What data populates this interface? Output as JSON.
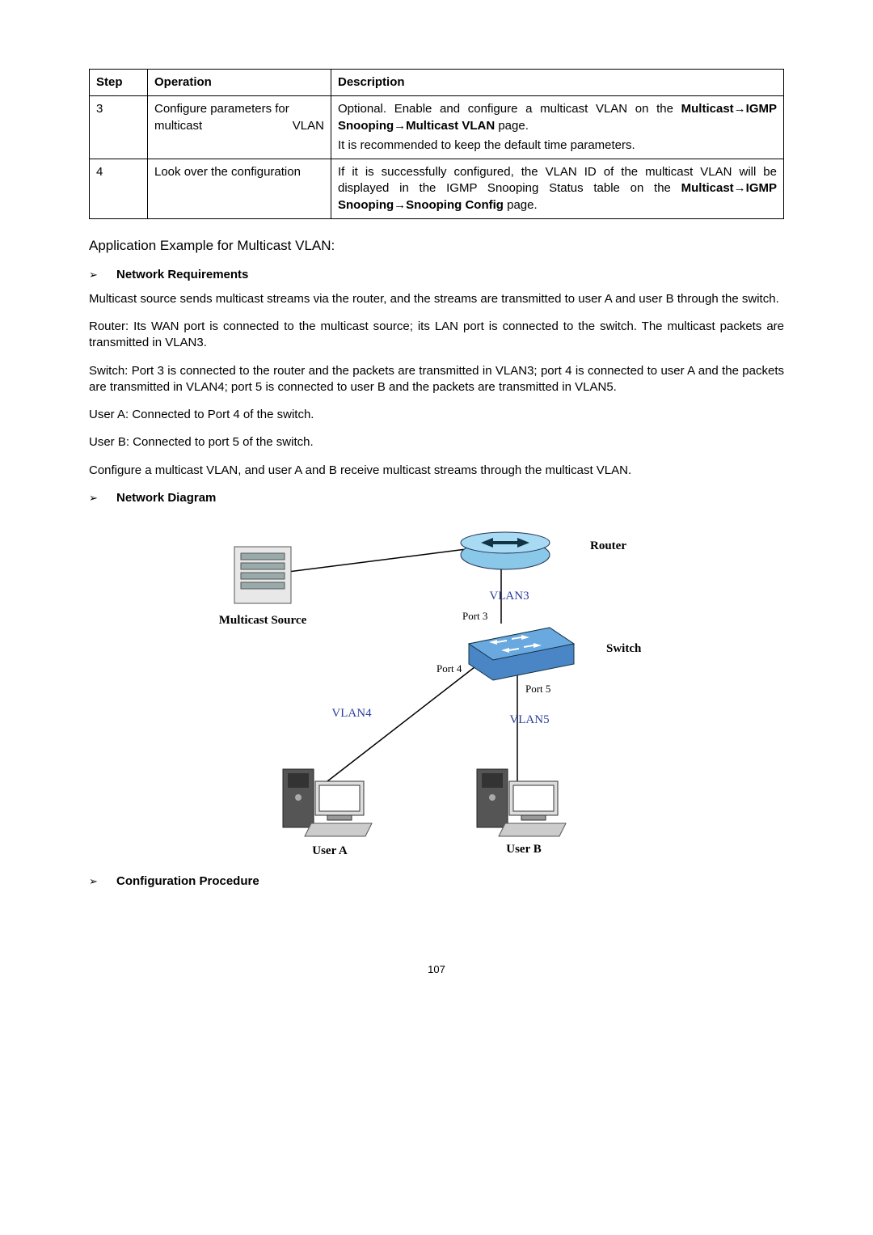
{
  "table": {
    "headers": {
      "step": "Step",
      "operation": "Operation",
      "description": "Description"
    },
    "rows": [
      {
        "step": "3",
        "operation": "Configure parameters for multicast VLAN",
        "desc_line1_pre": "Optional. Enable and configure a multicast VLAN on the ",
        "desc_line1_bold": "Multicast→IGMP Snooping→Multicast VLAN",
        "desc_line1_post": " page.",
        "desc_line2": "It is recommended to keep the default time parameters."
      },
      {
        "step": "4",
        "operation": "Look over the configuration",
        "desc_line1_pre": "If it is successfully configured, the VLAN ID of the multicast VLAN will be displayed in the IGMP Snooping Status table on the ",
        "desc_line1_bold": "Multicast→IGMP Snooping→Snooping Config",
        "desc_line1_post": " page."
      }
    ]
  },
  "heading_app": "Application Example for Multicast VLAN:",
  "bullets": {
    "net_req": "Network Requirements",
    "net_diag": "Network Diagram",
    "conf_proc": "Configuration Procedure"
  },
  "paras": {
    "p1": "Multicast source sends multicast streams via the router, and the streams are transmitted to user A and user B through the switch.",
    "p2": "Router: Its WAN port is connected to the multicast source; its LAN port is connected to the switch. The multicast packets are transmitted in VLAN3.",
    "p3": "Switch: Port 3 is connected to the router and the packets are transmitted in VLAN3; port 4 is connected to user A and the packets are transmitted in VLAN4; port 5 is connected to user B and the packets are transmitted in VLAN5.",
    "p4": "User A: Connected to Port 4 of the switch.",
    "p5": "User B: Connected to port 5 of the switch.",
    "p6": "Configure a multicast VLAN, and user A and B receive multicast streams through the multicast VLAN."
  },
  "diagram": {
    "multicast_source": "Multicast Source",
    "router": "Router",
    "switch": "Switch",
    "vlan3": "VLAN3",
    "vlan4": "VLAN4",
    "vlan5": "VLAN5",
    "port3": "Port 3",
    "port4": "Port 4",
    "port5": "Port 5",
    "userA": "User A",
    "userB": "User B"
  },
  "page_number": "107"
}
